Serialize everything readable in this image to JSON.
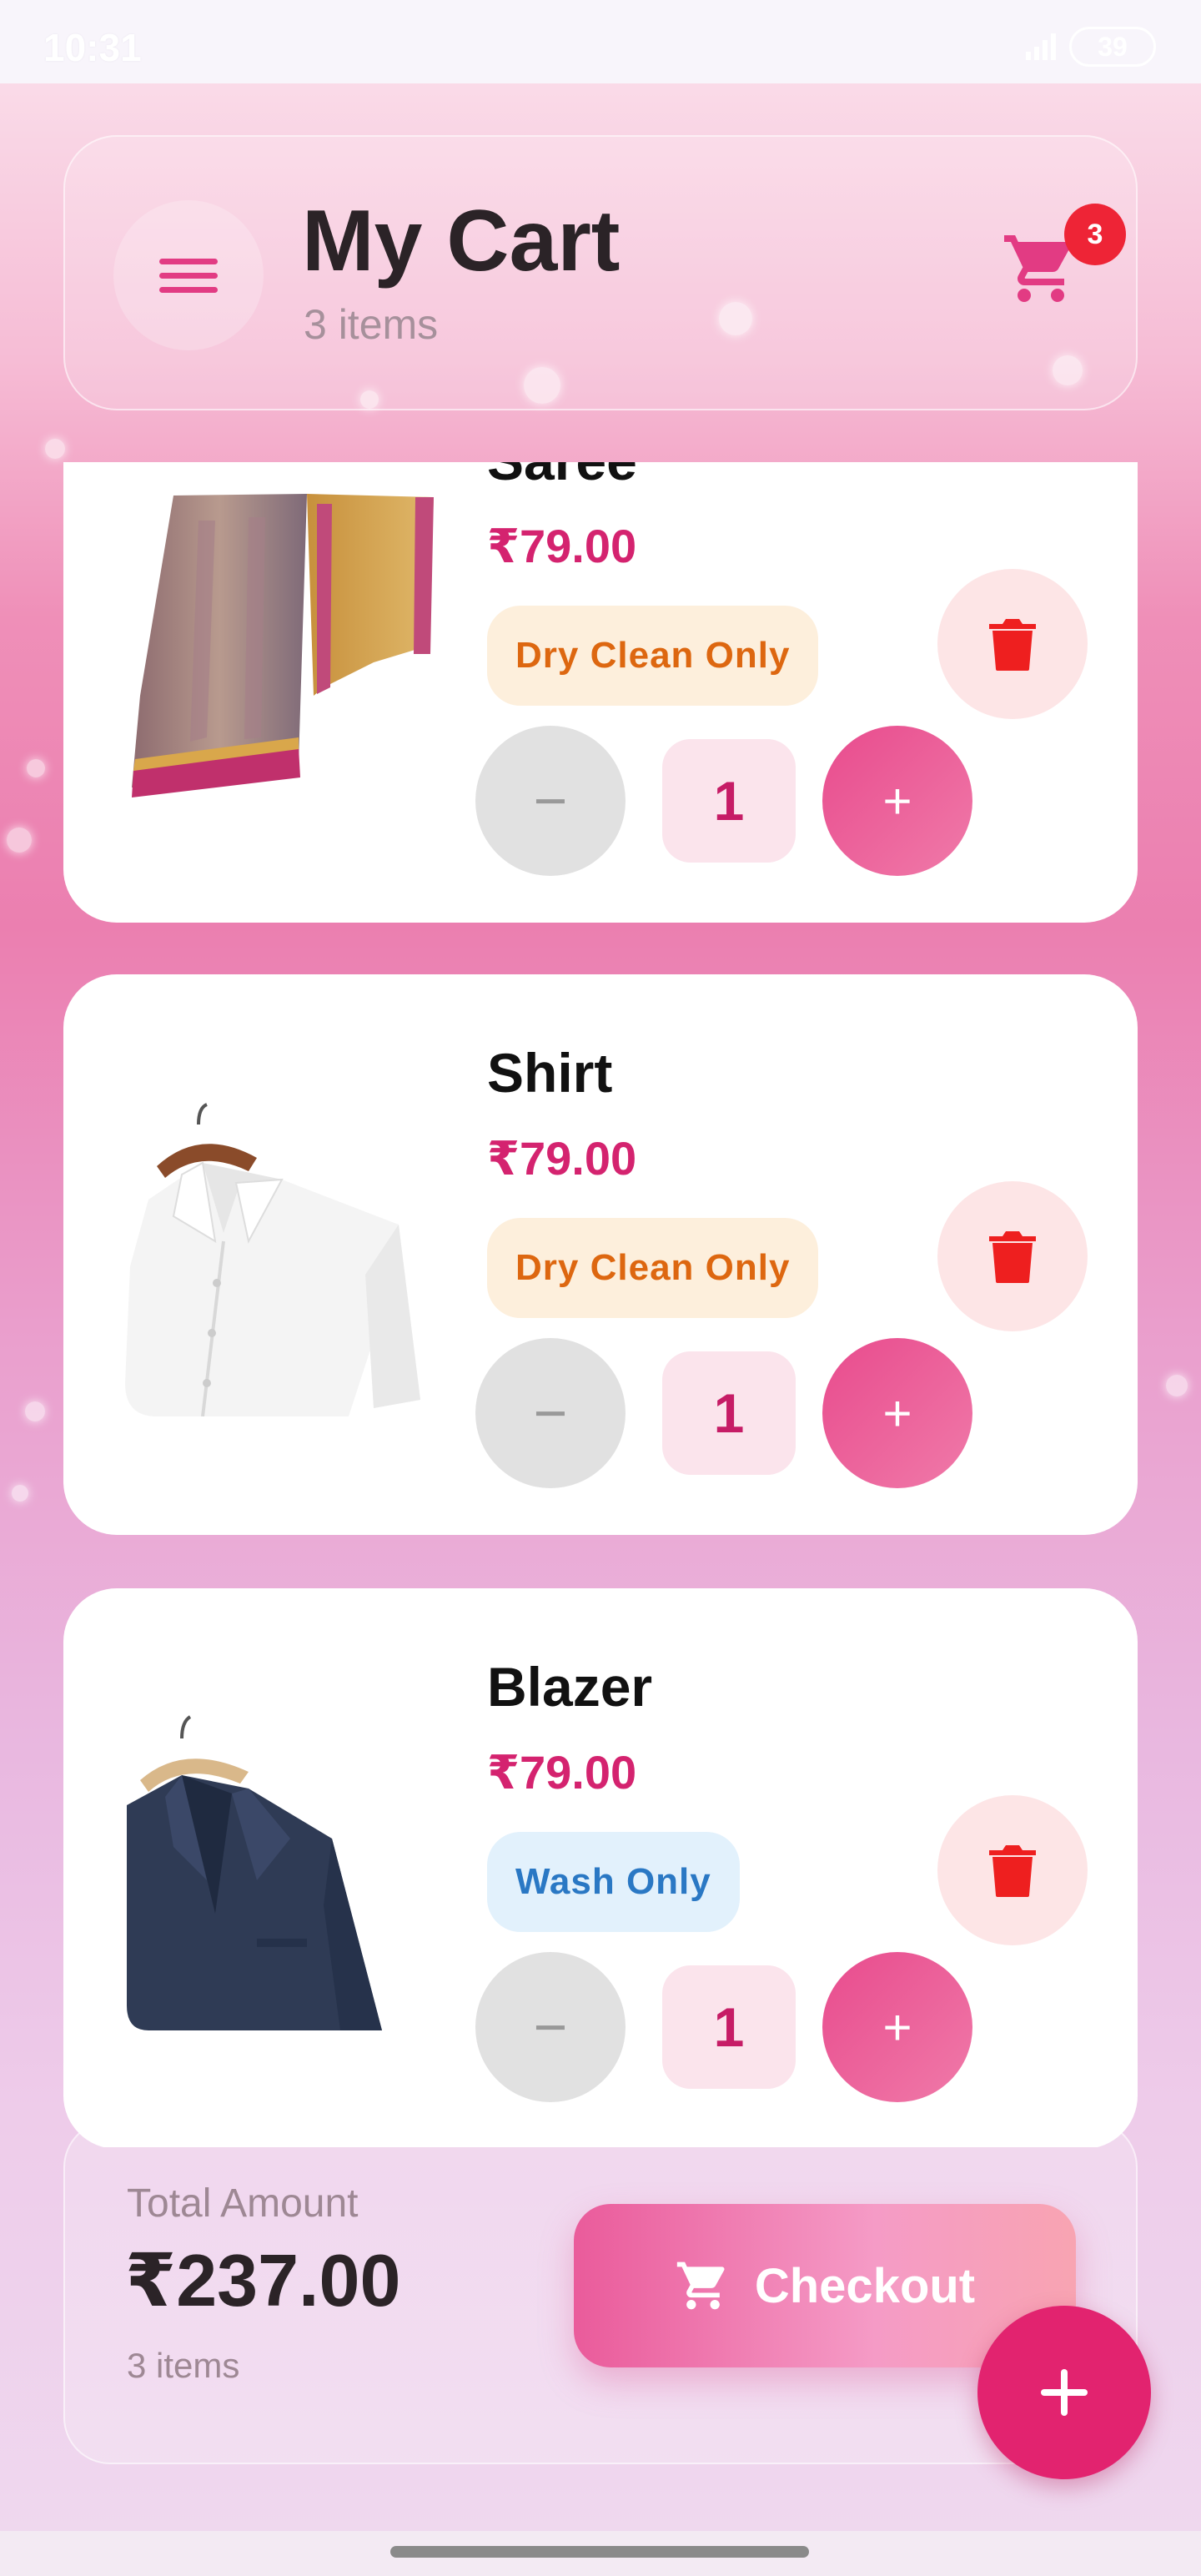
{
  "status_bar": {
    "time": "10:31",
    "battery": "39"
  },
  "header": {
    "title": "My Cart",
    "subtitle": "3 items",
    "cart_badge": "3",
    "icons": {
      "menu": "menu-icon",
      "cart": "shopping-cart-icon"
    }
  },
  "items": [
    {
      "name": "Saree",
      "price": "₹79.00",
      "service": "Dry Clean Only",
      "quantity": "1",
      "decrement": "−",
      "increment": "+"
    },
    {
      "name": "Shirt",
      "price": "₹79.00",
      "service": "Dry Clean Only",
      "quantity": "1",
      "decrement": "−",
      "increment": "+"
    },
    {
      "name": "Blazer",
      "price": "₹79.00",
      "service": "Wash Only",
      "quantity": "1",
      "decrement": "−",
      "increment": "+"
    }
  ],
  "summary": {
    "label": "Total Amount",
    "amount": "₹237.00",
    "count": "3 items",
    "checkout_label": "Checkout"
  },
  "colors": {
    "accent": "#e2236f",
    "price": "#d4236f",
    "dry_clean_tag_bg": "#fdefdc",
    "dry_clean_tag_text": "#dd6710",
    "wash_tag_bg": "#e2f1fc",
    "wash_tag_text": "#2a78c4",
    "delete": "#ee1f1f",
    "badge": "#ee2436"
  }
}
